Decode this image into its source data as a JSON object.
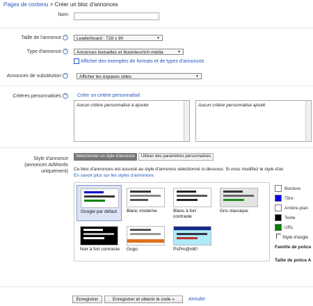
{
  "breadcrumb": {
    "link": "Pages de contenu",
    "sep": ">",
    "current": "Créer un bloc d'annonces"
  },
  "form": {
    "nom_label": "Nom",
    "nom_value": "",
    "taille_label": "Taille de l'annonce",
    "taille_value": "Leaderboard : 728 x 90",
    "type_label": "Type d'annonce",
    "type_value": "Annonces textuelles et illustrées/rich média",
    "examples_link": "Afficher des exemples de formats et de types d'annonces",
    "substitution_label": "Annonces de substitution",
    "substitution_value": "Afficher les espaces vides",
    "criteres_label": "Critères personnalisés",
    "create_link": "Créer un critère personnalisé",
    "list_left": "Aucun critère personnalisé à ajouter",
    "list_right": "Aucun critère personnalisé ajouté",
    "style_label": "Style d'annonce",
    "style_sublabel": "(annonces AdWords uniquement)",
    "tab_selected": "Sélectionner un style d'annonce",
    "tab_custom": "Utiliser des paramètres personnalisés",
    "style_info": "Ce bloc d'annonces est associé au style d'annonce sélectionné ci-dessous. Si vous modifiez le style d'an",
    "style_info_link": "En savoir plus sur les styles d'annonces",
    "styles": [
      "Google par défaut",
      "Blanc moderne",
      "Blanc à fort contraste",
      "Gris classique",
      "Noir à fort contraste",
      "Gogo",
      "PsPm@n80"
    ],
    "selected_style": "Google par défaut",
    "swatches": [
      {
        "label": "Bordure",
        "color": "#ffffff"
      },
      {
        "label": "Titre",
        "color": "#0000ee"
      },
      {
        "label": "Arrière-plan",
        "color": "#ffffff"
      },
      {
        "label": "Texte",
        "color": "#000000"
      },
      {
        "label": "URL",
        "color": "#008000"
      }
    ],
    "corner_label": "Style d'angle",
    "font_family_label": "Famille de police",
    "font_size_label": "Taille de police A"
  },
  "actions": {
    "save": "Enregistrer",
    "save_code": "Enregistrer et obtenir le code »",
    "cancel": "Annuler"
  }
}
